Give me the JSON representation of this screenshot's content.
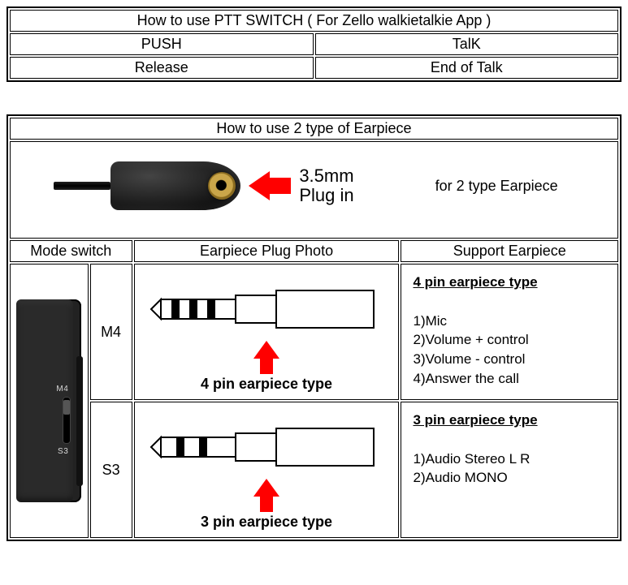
{
  "table1": {
    "title": "How to use PTT SWITCH  ( For  Zello walkietalkie App )",
    "r1c1": "PUSH",
    "r1c2": "TalK",
    "r2c1": "Release",
    "r2c2": "End of Talk"
  },
  "table2": {
    "title": "How to use 2 type of Earpiece",
    "jack_label_l1": "3.5mm",
    "jack_label_l2": "Plug in",
    "jack_right": "for 2 type Earpiece",
    "hdr_mode": "Mode switch",
    "hdr_photo": "Earpiece Plug Photo",
    "hdr_support": "Support Earpiece",
    "mode_m4": "M4",
    "mode_s3": "S3",
    "caption_4pin": "4 pin  earpiece type",
    "caption_3pin": "3 pin  earpiece type",
    "support_4pin_title": "4 pin  earpiece type",
    "support_4pin_1": "1)Mic",
    "support_4pin_2": "2)Volume + control",
    "support_4pin_3": "3)Volume -  control",
    "support_4pin_4": "4)Answer the call",
    "support_3pin_title": "3 pin  earpiece type",
    "support_3pin_1": "1)Audio  Stereo  L R",
    "support_3pin_2": "2)Audio  MONO",
    "device_m4": "M4",
    "device_s3": "S3"
  }
}
